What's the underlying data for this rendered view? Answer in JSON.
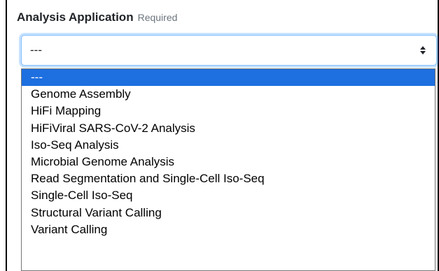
{
  "field": {
    "label": "Analysis Application",
    "required_text": "Required"
  },
  "select": {
    "value": "---",
    "icon": "sort-arrows-icon",
    "accent_color": "#80bdff"
  },
  "dropdown": {
    "selected_color": "#1e6fe0",
    "options": [
      {
        "label": "---",
        "selected": true
      },
      {
        "label": "Genome Assembly"
      },
      {
        "label": "HiFi Mapping"
      },
      {
        "label": "HiFiViral SARS-CoV-2 Analysis"
      },
      {
        "label": "Iso-Seq Analysis"
      },
      {
        "label": "Microbial Genome Analysis"
      },
      {
        "label": "Read Segmentation and Single-Cell Iso-Seq"
      },
      {
        "label": "Single-Cell Iso-Seq"
      },
      {
        "label": "Structural Variant Calling"
      },
      {
        "label": "Variant Calling"
      }
    ]
  }
}
